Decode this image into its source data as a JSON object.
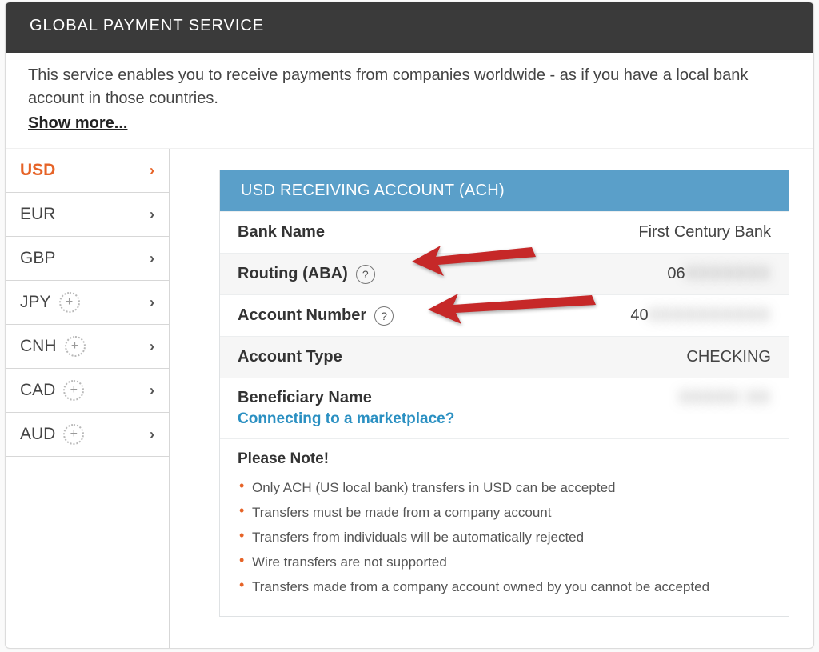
{
  "header": {
    "title": "GLOBAL PAYMENT SERVICE"
  },
  "intro": {
    "text": "This service enables you to receive payments from companies worldwide - as if you have a local bank account in those countries.",
    "show_more": "Show more..."
  },
  "sidebar": {
    "items": [
      {
        "code": "USD",
        "has_plus": false,
        "active": true
      },
      {
        "code": "EUR",
        "has_plus": false,
        "active": false
      },
      {
        "code": "GBP",
        "has_plus": false,
        "active": false
      },
      {
        "code": "JPY",
        "has_plus": true,
        "active": false
      },
      {
        "code": "CNH",
        "has_plus": true,
        "active": false
      },
      {
        "code": "CAD",
        "has_plus": true,
        "active": false
      },
      {
        "code": "AUD",
        "has_plus": true,
        "active": false
      }
    ]
  },
  "account": {
    "header": "USD RECEIVING ACCOUNT (ACH)",
    "rows": {
      "bank_name": {
        "label": "Bank Name",
        "value": "First Century Bank"
      },
      "routing": {
        "label": "Routing (ABA)",
        "value_visible": "06",
        "value_hidden": "XXXXXXX"
      },
      "account_number": {
        "label": "Account Number",
        "value_visible": "40",
        "value_hidden": "XXXXXXXXXX"
      },
      "account_type": {
        "label": "Account Type",
        "value": "CHECKING"
      },
      "beneficiary": {
        "label": "Beneficiary Name",
        "value_hidden": "XXXXX XX",
        "link": "Connecting to a marketplace?"
      }
    },
    "note": {
      "title": "Please Note!",
      "items": [
        "Only ACH (US local bank) transfers in USD can be accepted",
        "Transfers must be made from a company account",
        "Transfers from individuals will be automatically rejected",
        "Wire transfers are not supported",
        "Transfers made from a company account owned by you cannot be accepted"
      ]
    }
  },
  "icons": {
    "chevron": "›",
    "plus": "+",
    "help": "?"
  }
}
